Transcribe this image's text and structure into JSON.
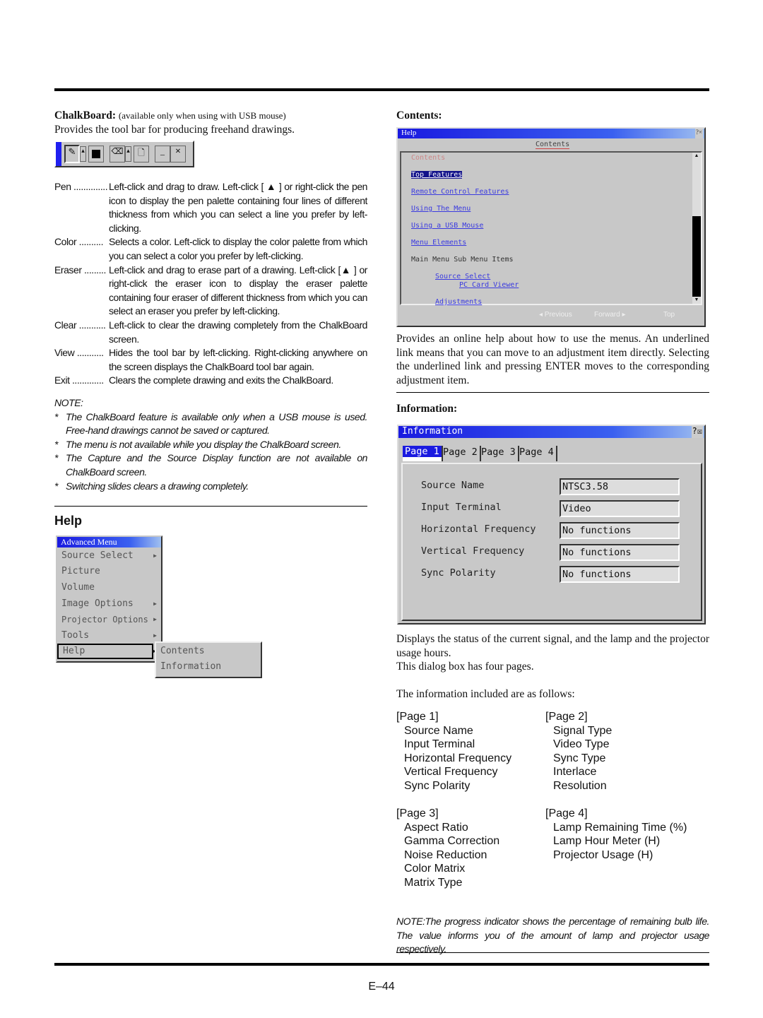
{
  "chalkboard": {
    "heading": "ChalkBoard:",
    "heading_note": "(available only when using with USB mouse)",
    "intro": "Provides the tool bar for producing freehand drawings.",
    "toolbar_icons": [
      "pen-icon",
      "dropdown-icon",
      "color-icon",
      "eraser-icon",
      "dropdown-icon",
      "clear-icon",
      "minimize-icon",
      "close-icon"
    ],
    "definitions": [
      {
        "term": "Pen ..............",
        "text": "Left-click and drag to draw. Left-click [ ▲ ] or right-click the pen icon to display the pen palette containing four lines of different thickness from which you can select a line you prefer by left-clicking."
      },
      {
        "term": "Color ..........",
        "text": "Selects a color. Left-click to display the color palette from which you can select a color you prefer by left-clicking."
      },
      {
        "term": "Eraser .........",
        "text": "Left-click and drag to erase part of a drawing. Left-click [▲ ] or right-click the eraser icon to display the eraser palette containing four eraser of different thickness from which you can select an eraser you prefer by left-clicking."
      },
      {
        "term": "Clear ...........",
        "text": "Left-click to clear the drawing completely from the ChalkBoard screen."
      },
      {
        "term": "View ...........",
        "text": "Hides the tool bar by left-clicking. Right-clicking anywhere on the screen displays the ChalkBoard tool bar again."
      },
      {
        "term": "Exit .............",
        "text": "Clears the complete drawing and exits the ChalkBoard."
      }
    ],
    "note_label": "NOTE:",
    "notes": [
      "The ChalkBoard feature is available only when a USB mouse is used. Free-hand drawings cannot be saved or captured.",
      "The menu is not available while you display the ChalkBoard screen.",
      "The Capture and the Source Display function are not available on ChalkBoard screen.",
      "Switching slides clears a drawing completely."
    ]
  },
  "help": {
    "heading": "Help",
    "menu_title": "Advanced Menu",
    "menu_items": [
      {
        "label": "Source Select",
        "arrow": true
      },
      {
        "label": "Picture",
        "arrow": false
      },
      {
        "label": "Volume",
        "arrow": false
      },
      {
        "label": "Image Options",
        "arrow": true
      },
      {
        "label": "Projector Options",
        "arrow": true
      },
      {
        "label": "Tools",
        "arrow": true
      },
      {
        "label": "Help",
        "arrow": true,
        "selected": true
      }
    ],
    "submenu": [
      "Contents",
      "Information"
    ]
  },
  "contents": {
    "heading": "Contents:",
    "window_title": "Help",
    "tab": "Contents",
    "page_heading": "Contents",
    "links": [
      "Top Features",
      "Remote Control Features",
      "Using The Menu",
      "Using a USB Mouse",
      "Menu Elements"
    ],
    "plain": "Main Menu Sub Menu Items",
    "sub_links": [
      "Source Select",
      "PC Card Viewer",
      "Adjustments"
    ],
    "buttons": [
      "◂ Previous",
      "Forward ▸",
      "Top"
    ],
    "description": "Provides an online help about how to use the menus. An underlined link means that you can move to an adjustment item directly. Selecting the underlined link and pressing ENTER moves to the corresponding adjustment item."
  },
  "information": {
    "heading": "Information:",
    "window_title": "Information",
    "tabs": [
      "Page 1",
      "Page 2",
      "Page 3",
      "Page 4"
    ],
    "rows": [
      {
        "label": "Source Name",
        "value": "NTSC3.58"
      },
      {
        "label": "Input Terminal",
        "value": "Video"
      },
      {
        "label": "Horizontal Frequency",
        "value": "No functions"
      },
      {
        "label": "Vertical Frequency",
        "value": "No functions"
      },
      {
        "label": "Sync Polarity",
        "value": "No functions"
      }
    ],
    "description": [
      "Displays the status of the current signal, and the lamp and the projector usage hours.",
      "This dialog box has four pages."
    ],
    "included": "The information included are as follows:",
    "pages": [
      {
        "title": "[Page 1]",
        "items": [
          "Source Name",
          "Input Terminal",
          "Horizontal Frequency",
          "Vertical Frequency",
          "Sync Polarity"
        ]
      },
      {
        "title": "[Page 2]",
        "items": [
          "Signal Type",
          "Video Type",
          "Sync Type",
          "Interlace",
          "Resolution"
        ]
      },
      {
        "title": "[Page 3]",
        "items": [
          "Aspect Ratio",
          "Gamma Correction",
          "Noise Reduction",
          "Color Matrix",
          "Matrix Type"
        ]
      },
      {
        "title": "[Page 4]",
        "items": [
          "Lamp Remaining Time (%)",
          "Lamp Hour Meter (H)",
          "Projector Usage (H)"
        ]
      }
    ],
    "note": "NOTE:The progress indicator shows the percentage of remaining bulb life. The value informs you of the amount of lamp and projector usage respectively."
  },
  "page_number": "E–44"
}
